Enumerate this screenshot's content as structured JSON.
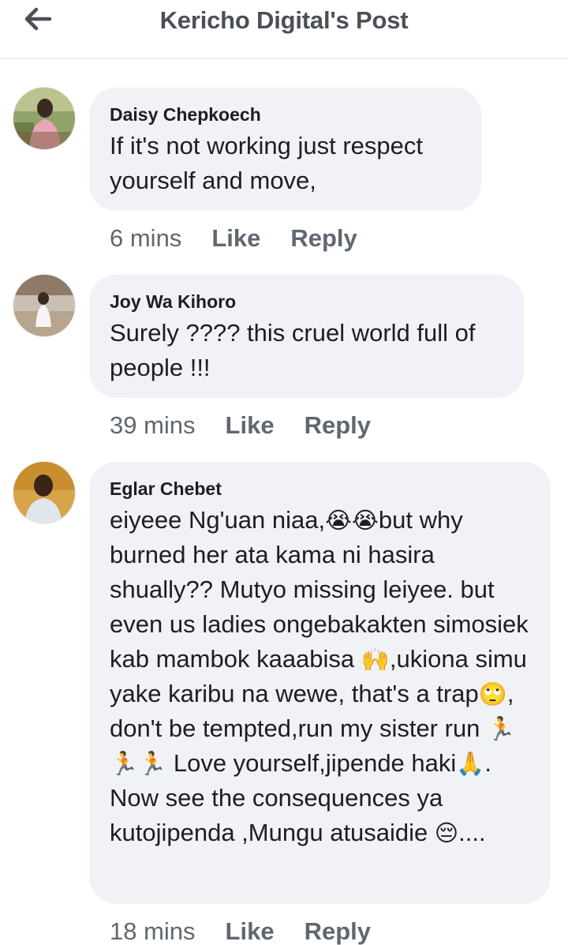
{
  "header": {
    "title": "Kericho Digital's Post",
    "back_icon": "arrow-left-icon"
  },
  "comments": [
    {
      "author": "Daisy Chepkoech",
      "text": "If it's not working just respect yourself and move,",
      "time": "6 mins",
      "like_label": "Like",
      "reply_label": "Reply"
    },
    {
      "author": "Joy Wa Kihoro",
      "text": "Surely ???? this cruel world full of people !!!",
      "time": "39 mins",
      "like_label": "Like",
      "reply_label": "Reply"
    },
    {
      "author": "Eglar Chebet",
      "text_parts": [
        "eiyeee Ng'uan niaa,",
        "😭😭",
        "but why burned her ata kama ni hasira shually?? Mutyo missing leiyee. but even us ladies ongebakakten simosiek kab mambok kaaabisa ",
        "🙌",
        ",ukiona simu yake karibu na wewe, that's a trap",
        "🙄",
        ", don't be tempted,run my sister run ",
        "🏃🏃🏃",
        " Love yourself,jipende haki",
        "🙏",
        ". Now see the consequences ya kutojipenda ,Mungu atusaidie ",
        "😔",
        "...."
      ],
      "time": "18 mins",
      "like_label": "Like",
      "reply_label": "Reply"
    }
  ],
  "colors": {
    "bubble": "#f0f2f5",
    "header_text": "#4b4f56",
    "meta_text": "#606770",
    "divider": "#dadde1"
  }
}
